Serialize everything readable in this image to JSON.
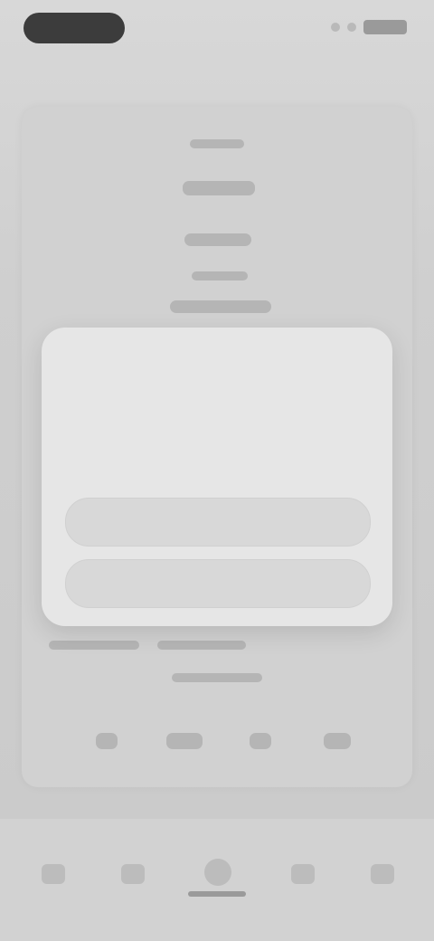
{
  "modal": {
    "title": "",
    "body": "",
    "primary_button_label": "",
    "secondary_button_label": ""
  }
}
